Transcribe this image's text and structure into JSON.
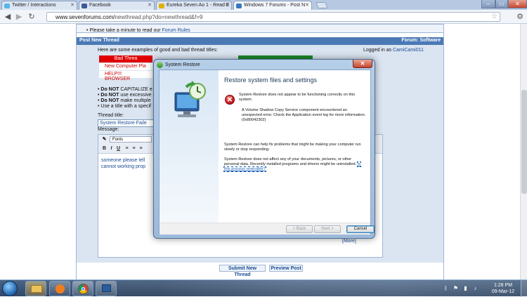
{
  "browser": {
    "tabs": [
      {
        "label": "Twitter / Interactions",
        "color": "#56b6e8"
      },
      {
        "label": "Facebook",
        "color": "#3b5998"
      },
      {
        "label": "Eureka Seven Ao 1 - Read E",
        "color": "#e0b000"
      },
      {
        "label": "Windows 7 Forums - Post N",
        "color": "#3a76c0"
      }
    ],
    "url_prefix": "www.sevenforums.com/",
    "url_path": "newthread.php?do=newthread&f=9",
    "window_buttons": [
      "–",
      "▭",
      "✕"
    ]
  },
  "forum": {
    "top_text_1": "",
    "top_text_2": "Please take a minute to read our",
    "forum_rules_link": "Forum Rules",
    "header_title": "Post New Thread",
    "header_forum_label": "Forum:",
    "header_forum_value": "Software",
    "examples_label": "Here are some examples of good and bad thread titles:",
    "logged_in_label": "Logged in as",
    "username": "CamiCami011",
    "example_titles": [
      "Bad Threa",
      "New Computer Pla",
      "HELP!!! BROWSER"
    ],
    "rules": [
      {
        "bold": "Do NOT",
        "rest": "CAPITALIZE e"
      },
      {
        "bold": "Do NOT",
        "rest": "use excessive"
      },
      {
        "bold": "Do NOT",
        "rest": "make multiple"
      },
      {
        "bold": "",
        "rest": "Use a title with a specif"
      }
    ],
    "thread_title_label": "Thread title:",
    "thread_title_value": "System Restore Faile",
    "message_label": "Message:",
    "font_select": "Fonts",
    "message_text_1": "someone please tell",
    "message_text_2": "cannot working prop",
    "more_link": "[More]",
    "submit_button": "Submit New Thread",
    "preview_button": "Preview Post"
  },
  "dialog": {
    "title": "System Restore",
    "close": "✕",
    "heading": "Restore system files and settings",
    "error_1": "System Restore does not appear to be functioning correctly on this system.",
    "error_2": "A Volume Shadow Copy Service component encountered an unexpected error. Check the Application event log for more information. (0x80042302)",
    "info_1": "System Restore can help fix problems that might be making your computer run slowly or stop responding.",
    "info_2": "System Restore does not affect any of your documents, pictures, or other personal data. Recently installed programs and drivers might be uninstalled.",
    "reversible_link": "Is this process reversible?",
    "back_button": "< Back",
    "next_button": "Next >",
    "cancel_button": "Cancel"
  },
  "taskbar": {
    "time": "1:28 PM",
    "date": "09-Mar-12",
    "tray_icons": [
      "bluetooth-icon",
      "flag-icon",
      "network-icon",
      "volume-icon"
    ]
  }
}
